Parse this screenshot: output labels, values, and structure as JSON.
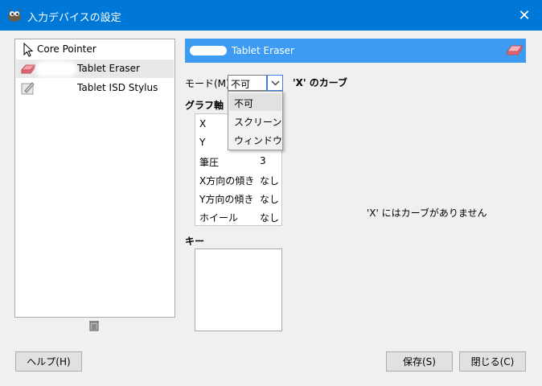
{
  "window": {
    "title": "入力デバイスの設定",
    "close_glyph": "✕",
    "icon": "gimp-wilber-icon"
  },
  "devices": [
    {
      "label": "Core Pointer",
      "icon": "cursor-arrow-icon",
      "selected": false
    },
    {
      "label": "Tablet Eraser",
      "icon": "eraser-icon",
      "selected": true
    },
    {
      "label": "Tablet ISD Stylus",
      "icon": "stylus-icon",
      "selected": false
    }
  ],
  "header": {
    "title": "Tablet Eraser",
    "color": "#3d9bf2"
  },
  "mode": {
    "label": "モード(M):",
    "value": "不可",
    "options": [
      "不可",
      "スクリーン",
      "ウィンドウ"
    ]
  },
  "curve": {
    "heading": "'X' のカーブ",
    "empty_message": "'X' にはカーブがありません"
  },
  "axes": {
    "heading": "グラフ軸",
    "rows": [
      {
        "name": "X",
        "value": ""
      },
      {
        "name": "Y",
        "value": ""
      },
      {
        "name": "筆圧",
        "value": "3"
      },
      {
        "name": "X方向の傾き",
        "value": "なし"
      },
      {
        "name": "Y方向の傾き",
        "value": "なし"
      },
      {
        "name": "ホイール",
        "value": "なし"
      }
    ]
  },
  "keys": {
    "heading": "キー"
  },
  "buttons": {
    "help": "ヘルプ(H)",
    "save": "保存(S)",
    "close": "閉じる(C)"
  },
  "colors": {
    "titlebar": "#0078d7",
    "accent": "#3d9bf2"
  }
}
